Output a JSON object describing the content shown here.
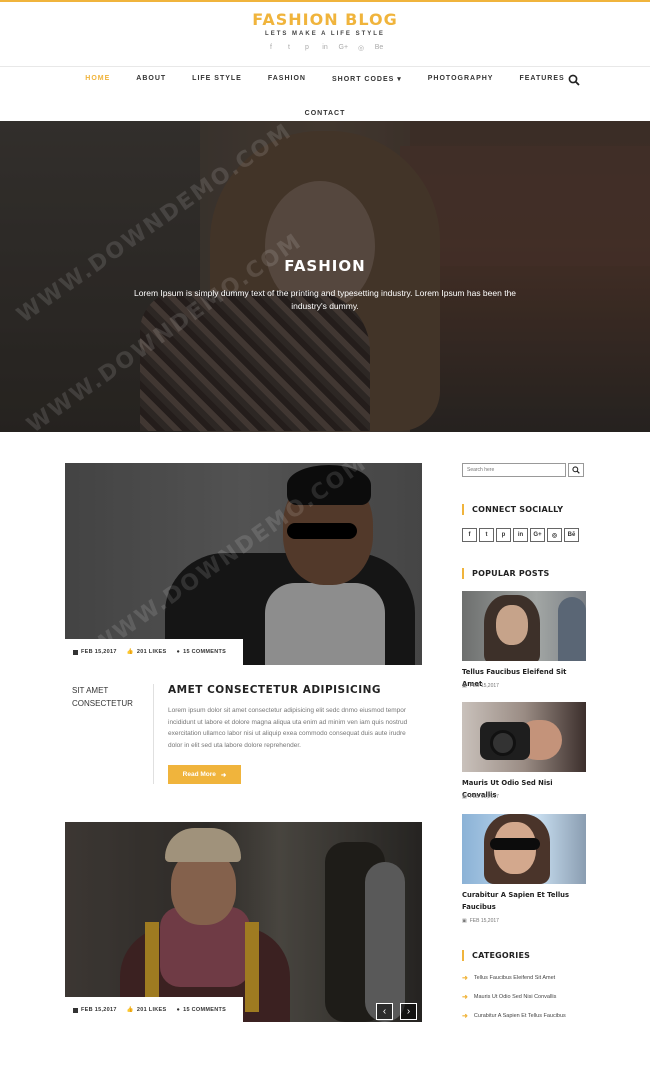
{
  "brand": {
    "title": "FASHION BLOG",
    "tagline": "LETS MAKE A LIFE STYLE",
    "accent_color": "#f0b43c",
    "social_icons": [
      "facebook-icon",
      "twitter-icon",
      "pinterest-icon",
      "linkedin-icon",
      "google-plus-icon",
      "rss-icon",
      "behance-icon"
    ],
    "social_glyphs": [
      "f",
      "t",
      "p",
      "in",
      "G+",
      "◎",
      "Be"
    ]
  },
  "nav": {
    "items": [
      "HOME",
      "ABOUT",
      "LIFE STYLE",
      "FASHION",
      "SHORT CODES ▾",
      "PHOTOGRAPHY",
      "FEATURES"
    ],
    "active": "HOME",
    "second_row": "CONTACT"
  },
  "hero": {
    "title": "FASHION",
    "text": "Lorem Ipsum is simply dummy text of the printing and typesetting industry. Lorem Ipsum has been the industry's dummy."
  },
  "posts": [
    {
      "date": "FEB 15,2017",
      "likes": "201 LIKES",
      "comments": "15 COMMENTS",
      "category": "SIT AMET CONSECTETUR",
      "title": "AMET CONSECTETUR ADIPISICING",
      "excerpt": "Lorem ipsum dolor sit amet consectetur adipisicing elit sedc dnmo eiusmod tempor incididunt ut labore et dolore magna aliqua uta enim ad minim ven iam quis nostrud exercitation ullamco labor nisi ut aliquip exea commodo consequat duis aute irudre dolor in elit sed uta labore dolore reprehender.",
      "read_more": "Read More"
    },
    {
      "date": "FEB 15,2017",
      "likes": "201 LIKES",
      "comments": "15 COMMENTS"
    }
  ],
  "slider": {
    "prev": "‹",
    "next": "›"
  },
  "sidebar": {
    "search_placeholder": "Search here",
    "connect_title": "CONNECT SOCIALLY",
    "social": [
      "f",
      "t",
      "p",
      "in",
      "G+",
      "◎",
      "Bē"
    ],
    "popular_title": "POPULAR POSTS",
    "popular": [
      {
        "title": "Tellus Faucibus Eleifend Sit Amet",
        "date": "FEB 15,2017"
      },
      {
        "title": "Mauris Ut Odio Sed Nisi Convallis",
        "date": "FEB 15,2017"
      },
      {
        "title": "Curabitur A Sapien Et Tellus Faucibus",
        "date": "FEB 15,2017"
      }
    ],
    "categories_title": "CATEGORIES",
    "categories": [
      "Tellus Faucibus Eleifend Sit Amet",
      "Mauris Ut Odio Sed Nisi Convallis",
      "Curabitur A Sapien Et Tellus Faucibus"
    ]
  },
  "watermark": "WWW.DOWNDEMO.COM"
}
